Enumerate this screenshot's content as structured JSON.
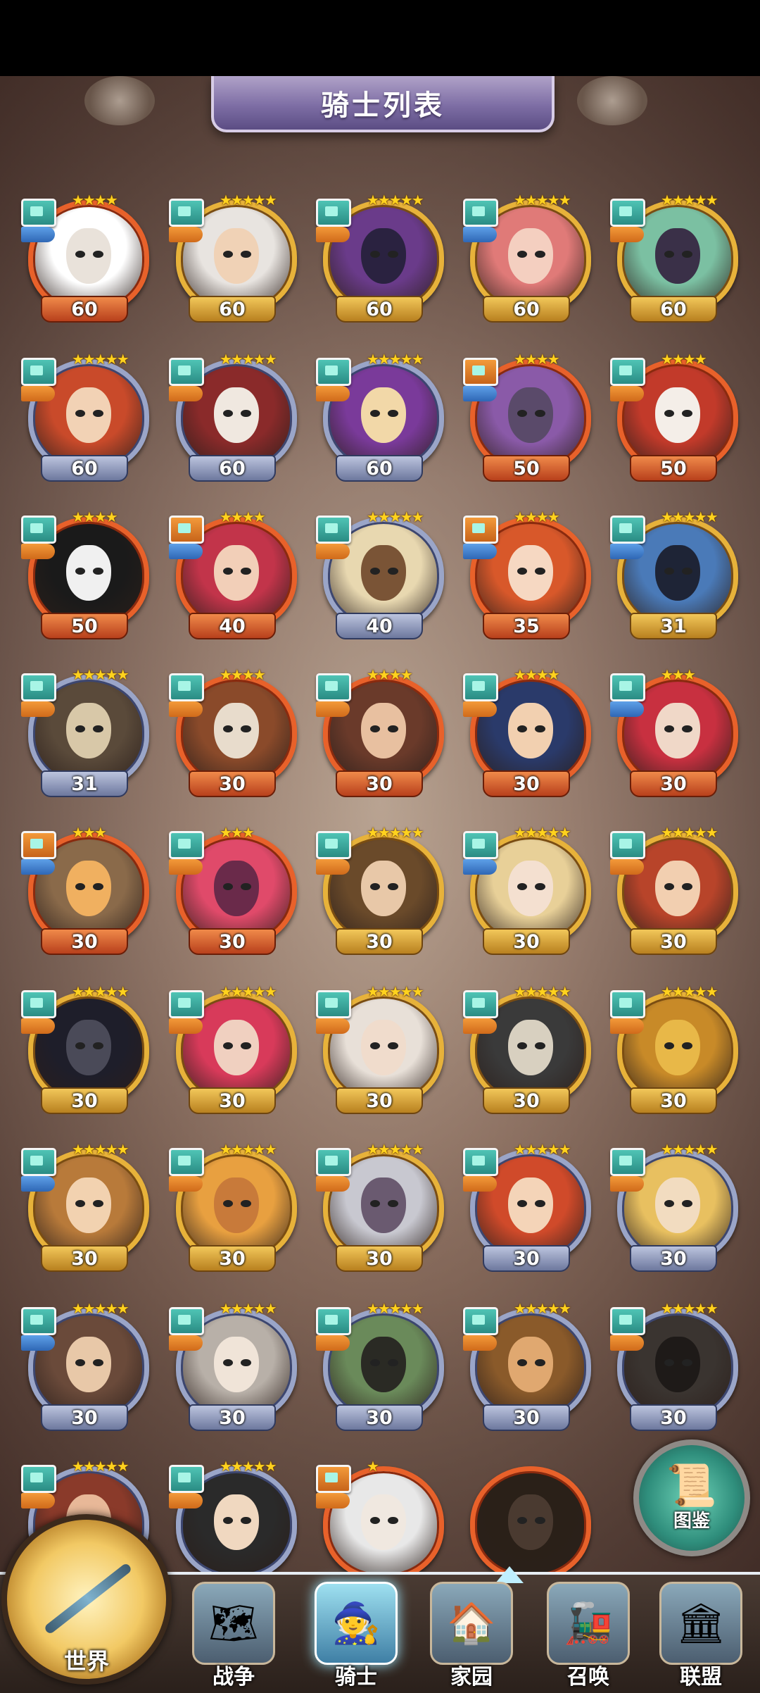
{
  "header": {
    "title": "骑士列表"
  },
  "knights": [
    {
      "level": "60",
      "stars": "★★★★",
      "frame": "red",
      "role": "teal",
      "tag": "blue",
      "skin": "#e9e2da",
      "hair": "#ffffff"
    },
    {
      "level": "60",
      "stars": "★★★★★",
      "frame": "gold",
      "role": "teal",
      "tag": "orange",
      "skin": "#f0d2b6",
      "hair": "#e8e4e0"
    },
    {
      "level": "60",
      "stars": "★★★★★",
      "frame": "gold",
      "role": "teal",
      "tag": "orange",
      "skin": "#2a2240",
      "hair": "#6a3b8a"
    },
    {
      "level": "60",
      "stars": "★★★★★",
      "frame": "gold",
      "role": "teal",
      "tag": "blue",
      "skin": "#f4cfc0",
      "hair": "#e07a78"
    },
    {
      "level": "60",
      "stars": "★★★★★",
      "frame": "gold",
      "role": "teal",
      "tag": "orange",
      "skin": "#3a3048",
      "hair": "#7bc0a2"
    },
    {
      "level": "60",
      "stars": "★★★★★",
      "frame": "blue",
      "role": "teal",
      "tag": "orange",
      "skin": "#f2d2b5",
      "hair": "#c94a2a"
    },
    {
      "level": "60",
      "stars": "★★★★★",
      "frame": "blue",
      "role": "teal",
      "tag": "orange",
      "skin": "#f0e8e0",
      "hair": "#8a2a2a"
    },
    {
      "level": "60",
      "stars": "★★★★★",
      "frame": "blue",
      "role": "teal",
      "tag": "orange",
      "skin": "#f2d8a8",
      "hair": "#7a3a9a"
    },
    {
      "level": "50",
      "stars": "★★★★",
      "frame": "red",
      "role": "orange",
      "tag": "blue",
      "skin": "#5a4a6a",
      "hair": "#8a5aa8"
    },
    {
      "level": "50",
      "stars": "★★★★",
      "frame": "red",
      "role": "teal",
      "tag": "orange",
      "skin": "#f4eee8",
      "hair": "#c23a2a"
    },
    {
      "level": "50",
      "stars": "★★★★",
      "frame": "red",
      "role": "teal",
      "tag": "orange",
      "skin": "#f0f0f0",
      "hair": "#1a1a1a"
    },
    {
      "level": "40",
      "stars": "★★★★",
      "frame": "red",
      "role": "orange",
      "tag": "blue",
      "skin": "#f2cfb8",
      "hair": "#c2344a"
    },
    {
      "level": "40",
      "stars": "★★★★★",
      "frame": "blue",
      "role": "teal",
      "tag": "orange",
      "skin": "#7a5436",
      "hair": "#e8d8b0"
    },
    {
      "level": "35",
      "stars": "★★★★",
      "frame": "red",
      "role": "orange",
      "tag": "blue",
      "skin": "#f6d8c2",
      "hair": "#d8582a"
    },
    {
      "level": "31",
      "stars": "★★★★★",
      "frame": "gold",
      "role": "teal",
      "tag": "blue",
      "skin": "#1e2436",
      "hair": "#4a7ab8"
    },
    {
      "level": "31",
      "stars": "★★★★★",
      "frame": "blue",
      "role": "teal",
      "tag": "orange",
      "skin": "#d8c8a8",
      "hair": "#5a4a3a"
    },
    {
      "level": "30",
      "stars": "★★★★",
      "frame": "red",
      "role": "teal",
      "tag": "orange",
      "skin": "#e8dccc",
      "hair": "#8a4a2a"
    },
    {
      "level": "30",
      "stars": "★★★★",
      "frame": "red",
      "role": "teal",
      "tag": "orange",
      "skin": "#e8c0a0",
      "hair": "#6a3a2a"
    },
    {
      "level": "30",
      "stars": "★★★★",
      "frame": "red",
      "role": "teal",
      "tag": "orange",
      "skin": "#f2d0b0",
      "hair": "#2a3a6a"
    },
    {
      "level": "30",
      "stars": "★★★",
      "frame": "red",
      "role": "teal",
      "tag": "blue",
      "skin": "#f0d8c8",
      "hair": "#c83040"
    },
    {
      "level": "30",
      "stars": "★★★",
      "frame": "red",
      "role": "orange",
      "tag": "blue",
      "skin": "#f0b060",
      "hair": "#8a6a4a"
    },
    {
      "level": "30",
      "stars": "★★★",
      "frame": "red",
      "role": "teal",
      "tag": "orange",
      "skin": "#6a2a4a",
      "hair": "#e04a6a"
    },
    {
      "level": "30",
      "stars": "★★★★★",
      "frame": "gold",
      "role": "teal",
      "tag": "orange",
      "skin": "#e8c8a8",
      "hair": "#6a4a2a"
    },
    {
      "level": "30",
      "stars": "★★★★★",
      "frame": "gold",
      "role": "teal",
      "tag": "blue",
      "skin": "#f4e0d0",
      "hair": "#e8d098"
    },
    {
      "level": "30",
      "stars": "★★★★★",
      "frame": "gold",
      "role": "teal",
      "tag": "orange",
      "skin": "#f2cfb0",
      "hair": "#b8442a"
    },
    {
      "level": "30",
      "stars": "★★★★★",
      "frame": "gold",
      "role": "teal",
      "tag": "orange",
      "skin": "#4a4a58",
      "hair": "#1e1e2a"
    },
    {
      "level": "30",
      "stars": "★★★★★",
      "frame": "gold",
      "role": "teal",
      "tag": "orange",
      "skin": "#f0d0c0",
      "hair": "#d83a5a"
    },
    {
      "level": "30",
      "stars": "★★★★★",
      "frame": "gold",
      "role": "teal",
      "tag": "orange",
      "skin": "#f0dccc",
      "hair": "#e8e0d8"
    },
    {
      "level": "30",
      "stars": "★★★★★",
      "frame": "gold",
      "role": "teal",
      "tag": "orange",
      "skin": "#d8d0c0",
      "hair": "#3a3a3a"
    },
    {
      "level": "30",
      "stars": "★★★★★",
      "frame": "gold",
      "role": "teal",
      "tag": "orange",
      "skin": "#e8b848",
      "hair": "#c88a28"
    },
    {
      "level": "30",
      "stars": "★★★★★",
      "frame": "gold",
      "role": "teal",
      "tag": "blue",
      "skin": "#f2d2b0",
      "hair": "#b87a3a"
    },
    {
      "level": "30",
      "stars": "★★★★★",
      "frame": "gold",
      "role": "teal",
      "tag": "orange",
      "skin": "#c87a3a",
      "hair": "#e8a040"
    },
    {
      "level": "30",
      "stars": "★★★★★",
      "frame": "gold",
      "role": "teal",
      "tag": "orange",
      "skin": "#6a5a70",
      "hair": "#c8c8d0"
    },
    {
      "level": "30",
      "stars": "★★★★★",
      "frame": "blue",
      "role": "teal",
      "tag": "orange",
      "skin": "#f4d4b8",
      "hair": "#d04a2a"
    },
    {
      "level": "30",
      "stars": "★★★★★",
      "frame": "blue",
      "role": "teal",
      "tag": "orange",
      "skin": "#f2dcc0",
      "hair": "#e8c060"
    },
    {
      "level": "30",
      "stars": "★★★★★",
      "frame": "blue",
      "role": "teal",
      "tag": "blue",
      "skin": "#e8c8a8",
      "hair": "#6a4a3a"
    },
    {
      "level": "30",
      "stars": "★★★★★",
      "frame": "blue",
      "role": "teal",
      "tag": "orange",
      "skin": "#f0e4d8",
      "hair": "#b8b0a8"
    },
    {
      "level": "30",
      "stars": "★★★★★",
      "frame": "blue",
      "role": "teal",
      "tag": "orange",
      "skin": "#2a2a24",
      "hair": "#6a8a5a"
    },
    {
      "level": "30",
      "stars": "★★★★★",
      "frame": "blue",
      "role": "teal",
      "tag": "orange",
      "skin": "#e0a870",
      "hair": "#8a5a2a"
    },
    {
      "level": "30",
      "stars": "★★★★★",
      "frame": "blue",
      "role": "teal",
      "tag": "orange",
      "skin": "#1e1a18",
      "hair": "#3a3430"
    },
    {
      "level": "",
      "stars": "★★★★★",
      "frame": "blue",
      "role": "teal",
      "tag": "orange",
      "skin": "#e8b898",
      "hair": "#8a3a2a"
    },
    {
      "level": "",
      "stars": "★★★★★",
      "frame": "blue",
      "role": "teal",
      "tag": "orange",
      "skin": "#f0d8c0",
      "hair": "#2a2a2a"
    },
    {
      "level": "",
      "stars": "★",
      "frame": "red",
      "role": "orange",
      "tag": "orange",
      "skin": "#f0e8e0",
      "hair": "#e8e8e8"
    },
    {
      "level": "",
      "stars": "",
      "frame": "red",
      "role": "none",
      "tag": "none",
      "skin": "#4a3a30",
      "hair": "#2a2018"
    }
  ],
  "nav": {
    "world": "世界",
    "war": "战争",
    "knight": "骑士",
    "home": "家园",
    "summon": "召唤",
    "alliance": "联盟",
    "atlas": "图鉴"
  },
  "colors": {
    "title_bar": "#7e6ea5",
    "frame_gold": "#e7b23a",
    "frame_red": "#e8612a",
    "frame_blue": "#9aa5c8",
    "star": "#ffd21e"
  },
  "icons": {
    "world": "compass-icon",
    "war": "map-icon",
    "knight": "knight-icon",
    "home": "house-icon",
    "summon": "train-icon",
    "alliance": "vault-icon",
    "atlas": "book-icon"
  }
}
